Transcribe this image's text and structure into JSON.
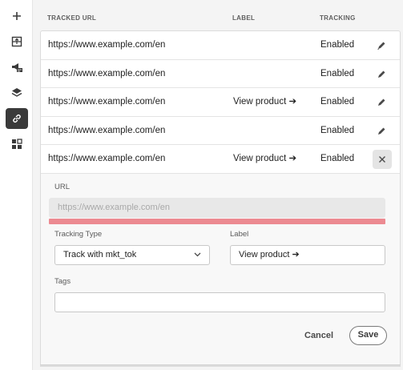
{
  "rail": {
    "items": [
      {
        "name": "add-icon",
        "active": false
      },
      {
        "name": "layout-icon",
        "active": false
      },
      {
        "name": "campaign-icon",
        "active": false
      },
      {
        "name": "layers-icon",
        "active": false
      },
      {
        "name": "link-icon",
        "active": true
      },
      {
        "name": "grid-icon",
        "active": false
      }
    ]
  },
  "table": {
    "headers": {
      "url": "TRACKED URL",
      "label": "LABEL",
      "tracking": "TRACKING"
    },
    "rows": [
      {
        "url": "https://www.example.com/en",
        "label": "",
        "tracking": "Enabled",
        "action": "edit-icon"
      },
      {
        "url": "https://www.example.com/en",
        "label": "",
        "tracking": "Enabled",
        "action": "edit-icon"
      },
      {
        "url": "https://www.example.com/en",
        "label": "View product ➔",
        "tracking": "Enabled",
        "action": "edit-icon"
      },
      {
        "url": "https://www.example.com/en",
        "label": "",
        "tracking": "Enabled",
        "action": "edit-icon"
      },
      {
        "url": "https://www.example.com/en",
        "label": "View product ➔",
        "tracking": "Enabled",
        "action": "close-icon"
      }
    ]
  },
  "editor": {
    "url_label": "URL",
    "url_placeholder": "https://www.example.com/en",
    "tracking_type_label": "Tracking Type",
    "tracking_type_value": "Track with mkt_tok",
    "label_label": "Label",
    "label_value": "View product ➔",
    "tags_label": "Tags",
    "tags_value": "",
    "cancel_label": "Cancel",
    "save_label": "Save",
    "error_color": "#ec8a91"
  }
}
